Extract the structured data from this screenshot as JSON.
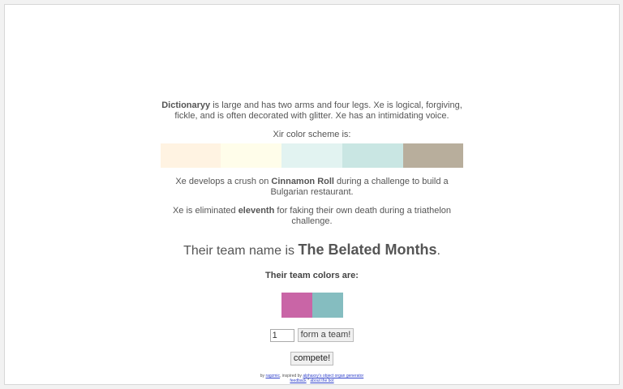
{
  "character": {
    "name": "Dictionaryy",
    "description": "is large and has two arms and four legs. Xe is logical, forgiving, fickle, and is often decorated with glitter. Xe has an intimidating voice."
  },
  "color_scheme": {
    "label": "Xir color scheme is:",
    "swatches": [
      "#fff3e2",
      "#fffdea",
      "#e2f3f1",
      "#c9e6e3",
      "#b8ae9c"
    ]
  },
  "crush": {
    "prefix": "Xe develops a crush on",
    "name": "Cinnamon Roll",
    "suffix": "during a challenge to build a Bulgarian restaurant."
  },
  "elimination": {
    "prefix": "Xe is eliminated",
    "place": "eleventh",
    "suffix": "for faking their own death during a triathelon challenge."
  },
  "team": {
    "prefix": "Their team name is",
    "name": "The Belated Months",
    "suffix": ".",
    "colors_label": "Their team colors are:",
    "colors": [
      "#c965a6",
      "#85bdc0"
    ]
  },
  "form": {
    "count_value": "1",
    "form_button": "form a team!",
    "compete_button": "compete!"
  },
  "footer": {
    "by": "by",
    "author": "ragzmic",
    "inspired": ", inspired by",
    "inspiration": "alphaxxy's object organ generator",
    "feedback": "feedback",
    "separator": "*",
    "about": "about the bot"
  }
}
